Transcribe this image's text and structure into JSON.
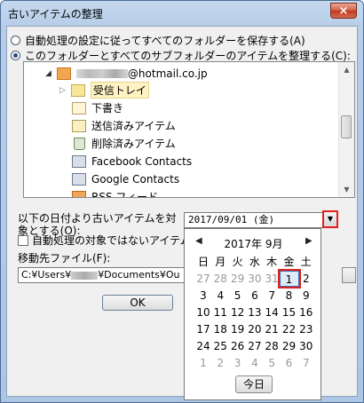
{
  "window": {
    "title": "古いアイテムの整理",
    "close_glyph": "×"
  },
  "radio": {
    "option1": "自動処理の設定に従ってすべてのフォルダーを保存する(A)",
    "option2": "このフォルダーとすべてのサブフォルダーのアイテムを整理する(C):",
    "selected": "option2"
  },
  "tree": {
    "account_suffix": "@hotmail.co.jp",
    "items": [
      "受信トレイ",
      "下書き",
      "送信済みアイテム",
      "削除済みアイテム",
      "Facebook Contacts",
      "Google Contacts",
      "RSS フィード"
    ]
  },
  "date": {
    "label": "以下の日付より古いアイテムを対象とする(O):",
    "value": "2017/09/01 (金)"
  },
  "checkbox_label": "自動処理の対象ではないアイテムを",
  "move_to": {
    "label": "移動先ファイル(F):",
    "path_prefix": "C:¥Users¥",
    "path_suffix": "¥Documents¥Ou"
  },
  "ok_label": "OK",
  "calendar": {
    "month_label": "2017年 9月",
    "weekdays": [
      "日",
      "月",
      "火",
      "水",
      "木",
      "金",
      "土"
    ],
    "rows": [
      [
        "27",
        "28",
        "29",
        "30",
        "31",
        "1",
        "2"
      ],
      [
        "3",
        "4",
        "5",
        "6",
        "7",
        "8",
        "9"
      ],
      [
        "10",
        "11",
        "12",
        "13",
        "14",
        "15",
        "16"
      ],
      [
        "17",
        "18",
        "19",
        "20",
        "21",
        "22",
        "23"
      ],
      [
        "24",
        "25",
        "26",
        "27",
        "28",
        "29",
        "30"
      ],
      [
        "1",
        "2",
        "3",
        "4",
        "5",
        "6",
        "7"
      ]
    ],
    "dim_cells": [
      "0-0",
      "0-1",
      "0-2",
      "0-3",
      "0-4",
      "5-0",
      "5-1",
      "5-2",
      "5-3",
      "5-4",
      "5-5",
      "5-6"
    ],
    "selected_cell": "0-5",
    "today_label": "今日"
  },
  "colors": {
    "highlight_red": "#e0201c",
    "selection_blue": "#3c6db2"
  }
}
